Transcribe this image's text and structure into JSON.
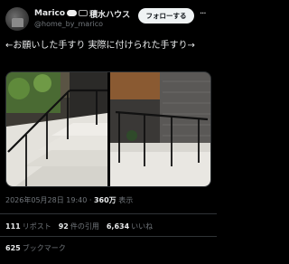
{
  "author": {
    "display_name": "Marico",
    "name_suffix": "積水ハウス",
    "handle": "@home_by_marico",
    "avatar": "house-avatar"
  },
  "follow_label": "フォローする",
  "more_label": "···",
  "tweet": {
    "text": "←お願いした手すり 実際に付けられた手すり→"
  },
  "images": [
    {
      "name": "requested-handrail-photo",
      "alt": ""
    },
    {
      "name": "installed-handrail-photo",
      "alt": ""
    }
  ],
  "meta": {
    "datetime": "2026年05月28日 19:40",
    "views_count": "360万",
    "views_label": "表示"
  },
  "stats": {
    "retweets_count": "111",
    "retweets_label": "リポスト",
    "quotes_count": "92",
    "quotes_label": "件の引用",
    "likes_count": "6,634",
    "likes_label": "いいね",
    "bookmarks_count": "625",
    "bookmarks_label": "ブックマーク"
  },
  "colors": {
    "background": "#000000",
    "text": "#e7e9ea",
    "muted": "#71767b",
    "divider": "#2f3336",
    "button_bg": "#eff3f4"
  }
}
